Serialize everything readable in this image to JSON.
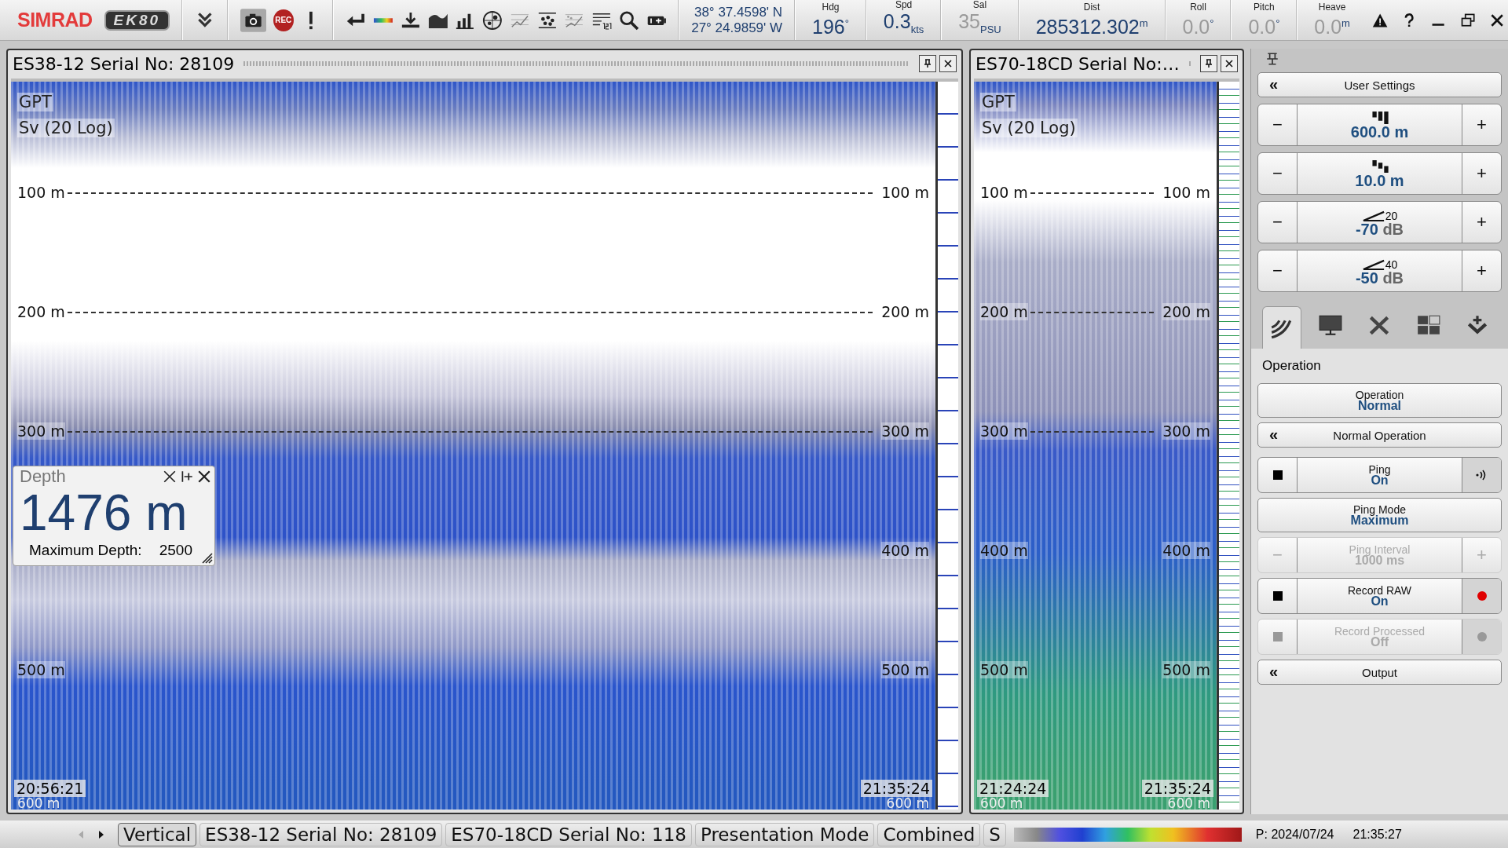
{
  "toolbar": {
    "logo": "SIMRAD",
    "product": "EK80",
    "record_label": "REC",
    "position": {
      "latitude": "38° 37.4598' N",
      "longitude": "27° 24.9859' W"
    },
    "readouts": [
      {
        "label": "Hdg",
        "value": "196",
        "unit": "°",
        "dimmed": false
      },
      {
        "label": "Spd",
        "value": "0.3",
        "unit": "kts",
        "dimmed": false
      },
      {
        "label": "Sal",
        "value": "35",
        "unit": "PSU",
        "dimmed": true
      },
      {
        "label": "Dist",
        "value": "285312.302",
        "unit": "m",
        "dimmed": false
      },
      {
        "label": "Roll",
        "value": "0.0",
        "unit": "°",
        "dimmed": true
      },
      {
        "label": "Pitch",
        "value": "0.0",
        "unit": "°",
        "dimmed": true
      },
      {
        "label": "Heave",
        "value": "0.0",
        "unit": "m",
        "dimmed": true
      }
    ]
  },
  "echograms": [
    {
      "title": "ES38-12 Serial No: 28109",
      "labels": [
        "GPT",
        "Sv (20 Log)"
      ],
      "depth_marks": [
        {
          "left": "100 m",
          "right": "100 m"
        },
        {
          "left": "200 m",
          "right": "200 m"
        },
        {
          "left": "300 m",
          "right": "300 m"
        },
        {
          "right": "400 m"
        },
        {
          "left": "500 m",
          "right": "500 m"
        }
      ],
      "start_time": "20:56:21",
      "end_time": "21:35:24",
      "bottom_left": "600 m",
      "bottom_right": "600 m"
    },
    {
      "title": "ES70-18CD Serial No:…",
      "labels": [
        "GPT",
        "Sv (20 Log)"
      ],
      "depth_marks": [
        {
          "left": "100 m",
          "right": "100 m"
        },
        {
          "left": "200 m",
          "right": "200 m"
        },
        {
          "left": "300 m",
          "right": "300 m"
        },
        {
          "left": "400 m",
          "right": "400 m"
        },
        {
          "left": "500 m",
          "right": "500 m"
        }
      ],
      "start_time": "21:24:24",
      "end_time": "21:35:24",
      "bottom_left": "600 m",
      "bottom_right": "600 m"
    }
  ],
  "depth_window": {
    "title": "Depth",
    "value": "1476 m",
    "max_label": "Maximum Depth:",
    "max_value": "2500"
  },
  "side_panel": {
    "user_settings": {
      "chevron": "«",
      "label": "User Settings"
    },
    "settings": [
      {
        "kind": "range",
        "decrease": "−",
        "value": "600.0",
        "unit": "m",
        "increase": "+"
      },
      {
        "kind": "start",
        "decrease": "−",
        "value": "10.0",
        "unit": "m",
        "increase": "+"
      },
      {
        "kind": "tvg",
        "decrease": "−",
        "exponent": "20",
        "value": "-70",
        "unit": "dB",
        "increase": "+"
      },
      {
        "kind": "tvg",
        "decrease": "−",
        "exponent": "40",
        "value": "-50",
        "unit": "dB",
        "increase": "+"
      }
    ],
    "tabs": [
      {
        "kind": "transducer",
        "selected": true
      },
      {
        "kind": "display",
        "selected": false
      },
      {
        "kind": "setup",
        "selected": false
      },
      {
        "kind": "layout",
        "selected": false
      },
      {
        "kind": "output",
        "selected": false
      }
    ],
    "section": "Operation",
    "controls": [
      {
        "kind": "dropdown",
        "label": "Operation",
        "value": "Normal",
        "disabled": false
      },
      {
        "kind": "menu",
        "chevron": "«",
        "label": "Normal Operation",
        "disabled": false
      },
      {
        "kind": "toggle",
        "label": "Ping",
        "value": "On",
        "indicator": {
          "kind": "sound"
        },
        "disabled": false
      },
      {
        "kind": "dropdown",
        "label": "Ping Mode",
        "value": "Maximum",
        "disabled": false
      },
      {
        "kind": "stepper",
        "decrease": "−",
        "label": "Ping Interval",
        "value": "1000 ms",
        "increase": "+",
        "disabled": true
      },
      {
        "kind": "toggle",
        "label": "Record RAW",
        "value": "On",
        "indicator": {
          "kind": "record"
        },
        "disabled": false
      },
      {
        "kind": "toggle",
        "label": "Record Processed",
        "value": "Off",
        "indicator": {
          "kind": "record"
        },
        "disabled": true
      },
      {
        "kind": "menu",
        "chevron": "«",
        "label": "Output",
        "disabled": false
      }
    ]
  },
  "status_bar": {
    "tabs": [
      {
        "label": "Vertical",
        "selected": true
      },
      {
        "label": "ES38-12 Serial No: 28109",
        "selected": false
      },
      {
        "label": "ES70-18CD Serial No: 118",
        "selected": false
      },
      {
        "label": "Presentation Mode",
        "selected": false
      },
      {
        "label": "Combined",
        "selected": false
      },
      {
        "label": "S",
        "selected": false
      }
    ],
    "date": "P: 2024/07/24",
    "time": "21:35:27"
  }
}
